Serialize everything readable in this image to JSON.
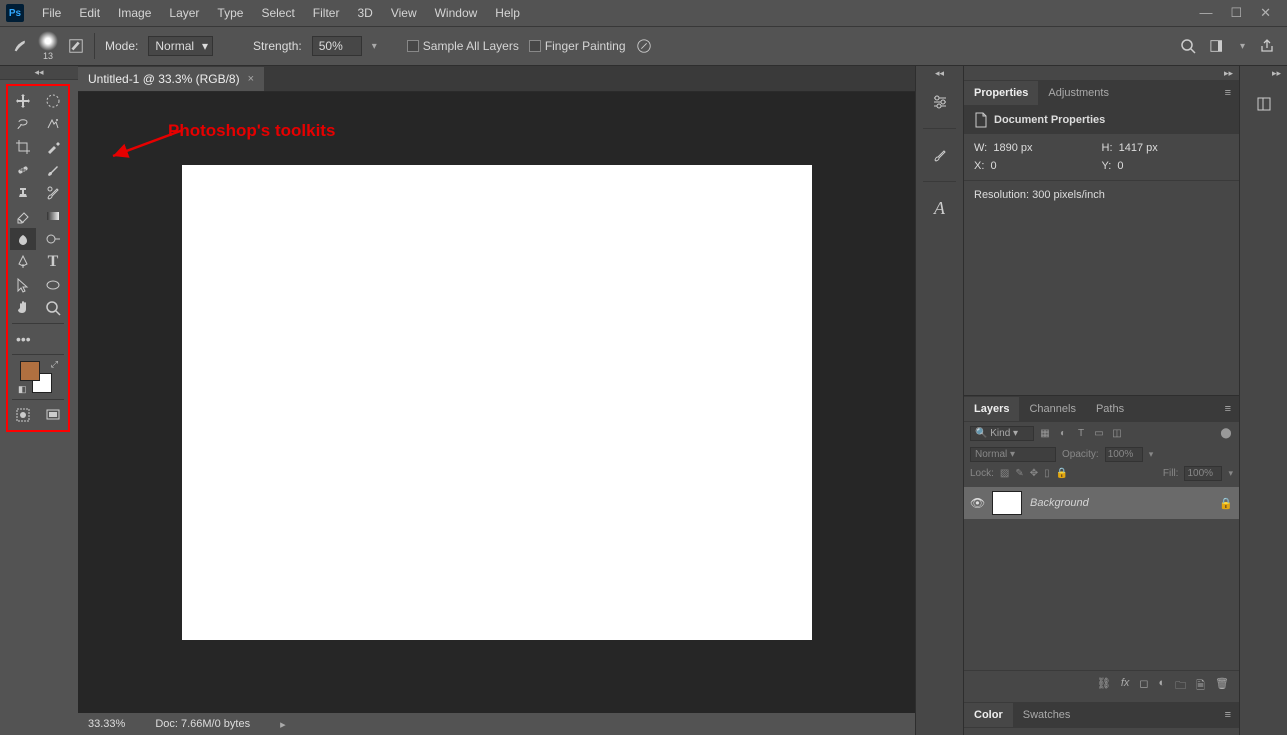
{
  "app": {
    "logo_text": "Ps"
  },
  "menubar": [
    "File",
    "Edit",
    "Image",
    "Layer",
    "Type",
    "Select",
    "Filter",
    "3D",
    "View",
    "Window",
    "Help"
  ],
  "optionsbar": {
    "brush_size": "13",
    "mode_label": "Mode:",
    "mode_value": "Normal",
    "strength_label": "Strength:",
    "strength_value": "50%",
    "sample_all_label": "Sample All Layers",
    "finger_label": "Finger Painting"
  },
  "document": {
    "tab_title": "Untitled-1 @ 33.3% (RGB/8)",
    "zoom": "33.33%",
    "doc_info": "Doc: 7.66M/0 bytes"
  },
  "annotation": "Photoshop's toolkits",
  "tools": {
    "left": [
      "move",
      "lasso",
      "crop",
      "eyedropper",
      "clone",
      "patch",
      "blur",
      "pen",
      "path-select",
      "hand",
      "more"
    ],
    "right": [
      "marquee",
      "magic-wand",
      "slice",
      "brush",
      "history-brush",
      "gradient",
      "dodge",
      "type",
      "ellipse",
      "zoom",
      ""
    ]
  },
  "properties": {
    "panel_label": "Properties",
    "adjustments_label": "Adjustments",
    "header": "Document Properties",
    "w_label": "W:",
    "w_value": "1890 px",
    "h_label": "H:",
    "h_value": "1417 px",
    "x_label": "X:",
    "x_value": "0",
    "y_label": "Y:",
    "y_value": "0",
    "resolution": "Resolution: 300 pixels/inch"
  },
  "layers": {
    "layers_tab": "Layers",
    "channels_tab": "Channels",
    "paths_tab": "Paths",
    "kind_label": "Kind",
    "blend_value": "Normal",
    "opacity_label": "Opacity:",
    "opacity_value": "100%",
    "lock_label": "Lock:",
    "fill_label": "Fill:",
    "fill_value": "100%",
    "bg_layer": "Background"
  },
  "color_panel": {
    "color_tab": "Color",
    "swatches_tab": "Swatches"
  },
  "colors": {
    "foreground": "#b07040",
    "background": "#ffffff"
  }
}
